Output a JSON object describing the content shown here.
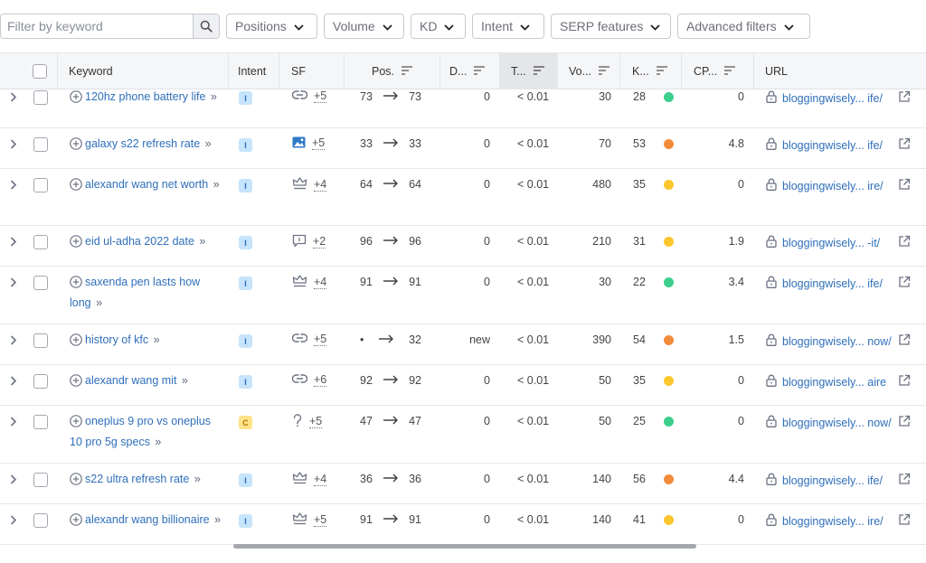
{
  "toolbar": {
    "search_placeholder": "Filter by keyword",
    "filters": [
      "Positions",
      "Volume",
      "KD",
      "Intent",
      "SERP features",
      "Advanced filters"
    ]
  },
  "columns": {
    "keyword": "Keyword",
    "intent": "Intent",
    "sf": "SF",
    "pos": "Pos.",
    "diff": "D...",
    "traffic": "T...",
    "volume": "Vo...",
    "kd": "K...",
    "cpc": "CP...",
    "url": "URL"
  },
  "colors": {
    "green": "#3ccf8e",
    "orange": "#f28c3b",
    "yellow": "#fcc62d",
    "link": "#2f6fba"
  },
  "rows": [
    {
      "keyword": "120hz phone battery life",
      "intent": "I",
      "sf_icon": "link-icon",
      "sf_more": "+5",
      "pos_from": "73",
      "pos_to": "73",
      "diff": "0",
      "traffic": "< 0.01",
      "volume": "30",
      "kd": "28",
      "kd_color": "green",
      "cpc": "0",
      "url": "bloggingwisely... ife/"
    },
    {
      "keyword": "galaxy s22 refresh rate",
      "intent": "I",
      "sf_icon": "image-icon",
      "sf_more": "+5",
      "pos_from": "33",
      "pos_to": "33",
      "diff": "0",
      "traffic": "< 0.01",
      "volume": "70",
      "kd": "53",
      "kd_color": "orange",
      "cpc": "4.8",
      "url": "bloggingwisely... ife/"
    },
    {
      "keyword": "alexandr wang net worth",
      "intent": "I",
      "sf_icon": "crown-icon",
      "sf_more": "+4",
      "pos_from": "64",
      "pos_to": "64",
      "diff": "0",
      "traffic": "< 0.01",
      "volume": "480",
      "kd": "35",
      "kd_color": "yellow",
      "cpc": "0",
      "url": "bloggingwisely... ire/"
    },
    {
      "keyword": "eid ul-adha 2022 date",
      "intent": "I",
      "sf_icon": "review-icon",
      "sf_more": "+2",
      "pos_from": "96",
      "pos_to": "96",
      "diff": "0",
      "traffic": "< 0.01",
      "volume": "210",
      "kd": "31",
      "kd_color": "yellow",
      "cpc": "1.9",
      "url": "bloggingwisely... -it/"
    },
    {
      "keyword": "saxenda pen lasts how long",
      "intent": "I",
      "sf_icon": "crown-icon",
      "sf_more": "+4",
      "pos_from": "91",
      "pos_to": "91",
      "diff": "0",
      "traffic": "< 0.01",
      "volume": "30",
      "kd": "22",
      "kd_color": "green",
      "cpc": "3.4",
      "url": "bloggingwisely... ife/"
    },
    {
      "keyword": "history of kfc",
      "intent": "I",
      "sf_icon": "link-icon",
      "sf_more": "+5",
      "pos_from": "•",
      "pos_to": "32",
      "diff": "new",
      "traffic": "< 0.01",
      "volume": "390",
      "kd": "54",
      "kd_color": "orange",
      "cpc": "1.5",
      "url": "bloggingwisely... now/"
    },
    {
      "keyword": "alexandr wang mit",
      "intent": "I",
      "sf_icon": "link-icon",
      "sf_more": "+6",
      "pos_from": "92",
      "pos_to": "92",
      "diff": "0",
      "traffic": "< 0.01",
      "volume": "50",
      "kd": "35",
      "kd_color": "yellow",
      "cpc": "0",
      "url": "bloggingwisely... aire"
    },
    {
      "keyword": "oneplus 9 pro vs oneplus 10 pro 5g specs",
      "intent": "C",
      "sf_icon": "question-icon",
      "sf_more": "+5",
      "pos_from": "47",
      "pos_to": "47",
      "diff": "0",
      "traffic": "< 0.01",
      "volume": "50",
      "kd": "25",
      "kd_color": "green",
      "cpc": "0",
      "url": "bloggingwisely... now/"
    },
    {
      "keyword": "s22 ultra refresh rate",
      "intent": "I",
      "sf_icon": "crown-icon",
      "sf_more": "+4",
      "pos_from": "36",
      "pos_to": "36",
      "diff": "0",
      "traffic": "< 0.01",
      "volume": "140",
      "kd": "56",
      "kd_color": "orange",
      "cpc": "4.4",
      "url": "bloggingwisely... ife/"
    },
    {
      "keyword": "alexandr wang billionaire",
      "intent": "I",
      "sf_icon": "crown-icon",
      "sf_more": "+5",
      "pos_from": "91",
      "pos_to": "91",
      "diff": "0",
      "traffic": "< 0.01",
      "volume": "140",
      "kd": "41",
      "kd_color": "yellow",
      "cpc": "0",
      "url": "bloggingwisely... ire/"
    }
  ]
}
